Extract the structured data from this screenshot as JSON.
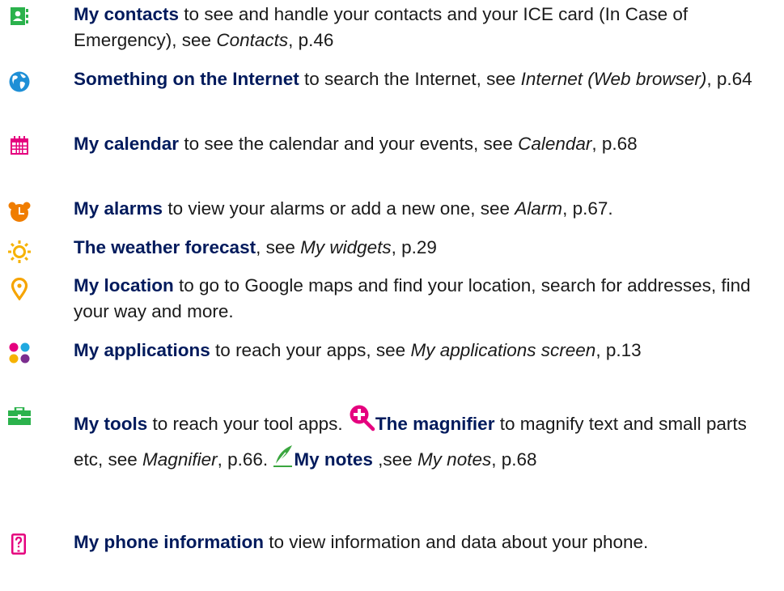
{
  "colors": {
    "bold_text": "#001a5c",
    "body_text": "#1a1a1a",
    "contacts_icon": "#2bb24c",
    "globe_icon": "#1e8fd6",
    "calendar_icon": "#e5007e",
    "alarm_icon": "#f07d00",
    "weather_icon": "#f6b200",
    "location_icon": "#f6a400",
    "tools_icon": "#2bb24c",
    "magnifier_icon": "#e5007e",
    "notes_icon": "#3aa63f",
    "phone_info_icon": "#e5007e"
  },
  "icons": {
    "contacts": "contacts-book-icon",
    "internet": "globe-icon",
    "calendar": "calendar-icon",
    "alarms": "alarm-clock-icon",
    "weather": "sun-icon",
    "location": "map-pin-icon",
    "applications": "app-grid-icon",
    "tools": "toolbox-icon",
    "magnifier": "magnifier-icon",
    "notes": "pen-icon",
    "phone_info": "phone-question-icon"
  },
  "entries": {
    "contacts": {
      "title": "My contacts",
      "t1": " to see and handle your contacts and your ICE card (In Case of Emergency), see ",
      "ref": "Contacts",
      "t2": ", p.46"
    },
    "internet": {
      "title": "Something on the Internet",
      "t1": " to search the Internet, see ",
      "ref": "Internet (Web browser)",
      "t2": ", p.64"
    },
    "calendar": {
      "title": "My calendar",
      "t1": " to see the calendar and your events, see ",
      "ref": "Calendar",
      "t2": ", p.68"
    },
    "alarms": {
      "title": "My alarms",
      "t1": " to view your alarms or add a new one, see ",
      "ref": "Alarm",
      "t2": ", p.67."
    },
    "weather": {
      "title": "The weather forecast",
      "t1": ", see ",
      "ref": "My widgets",
      "t2": ", p.29"
    },
    "location": {
      "title": "My location",
      "t1": " to go to Google maps and find your location, search for addresses, find your way and more."
    },
    "applications": {
      "title": "My applications",
      "t1": " to reach your apps, see ",
      "ref": "My applications screen",
      "t2": ", p.13"
    },
    "tools": {
      "title": "My tools",
      "t1": " to reach your tool apps. ",
      "magnifier_title": "The magnifier",
      "t2": " to magnify text and small parts etc, see ",
      "ref1": "Magnifier",
      "t3": ", p.66. ",
      "notes_title": "My notes",
      "t4": " ,see ",
      "ref2": "My notes",
      "t5": ", p.68"
    },
    "phone_info": {
      "title": "My phone information",
      "t1": " to view information and data about your phone."
    }
  }
}
